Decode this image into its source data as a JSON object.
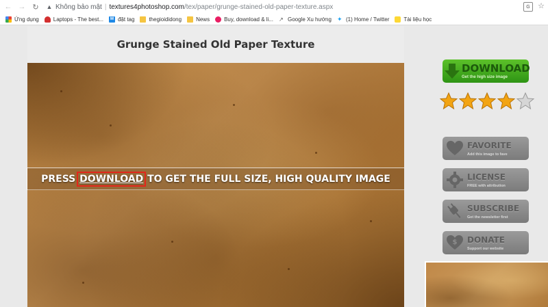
{
  "browser": {
    "security_label": "Không bảo mật",
    "url_host": "textures4photoshop.com",
    "url_path": "/tex/paper/grunge-stained-old-paper-texture.aspx"
  },
  "bookmarks": [
    {
      "label": "Ứng dụng",
      "icon": "apps-icon"
    },
    {
      "label": "Laptops - The best...",
      "icon": "laptops-icon"
    },
    {
      "label": "đặt tag",
      "icon": "dat-tag-icon"
    },
    {
      "label": "thegioididong",
      "icon": "folder-icon"
    },
    {
      "label": "News",
      "icon": "folder-icon"
    },
    {
      "label": "Buy, download & li...",
      "icon": "buy-icon"
    },
    {
      "label": "Google Xu hướng",
      "icon": "trend-icon"
    },
    {
      "label": "(1) Home / Twitter",
      "icon": "twitter-icon"
    },
    {
      "label": "Tài liệu học",
      "icon": "bookmark-folder-icon"
    }
  ],
  "page": {
    "title": "Grunge Stained Old Paper Texture",
    "press_before": "PRESS ",
    "press_link": "DOWNLOAD",
    "press_after": " TO GET THE FULL SIZE, HIGH QUALITY IMAGE"
  },
  "sidebar": {
    "download": {
      "label": "DOWNLOAD",
      "sub": "Get the high size image"
    },
    "rating": {
      "value": 4,
      "max": 5
    },
    "favorite": {
      "label": "FAVORITE",
      "sub": "Add this image to fave"
    },
    "license": {
      "label": "LICENSE",
      "sub": "FREE with attribution"
    },
    "subscribe": {
      "label": "SUBSCRIBE",
      "sub": "Get the newsletter first"
    },
    "donate": {
      "label": "DONATE",
      "sub": "Support our website"
    }
  },
  "colors": {
    "download_green": "#3aa81c",
    "highlight_red": "#e3261b",
    "star_gold": "#f2a413"
  }
}
